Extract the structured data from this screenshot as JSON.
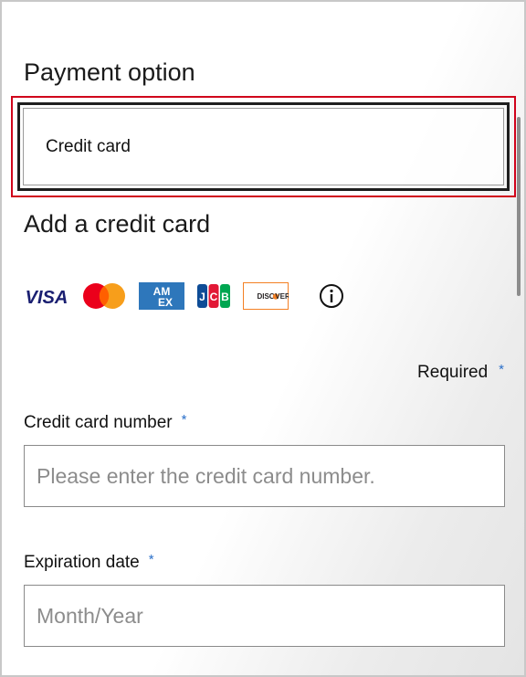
{
  "payment": {
    "title": "Payment option",
    "selected_option": "Credit card"
  },
  "add_card": {
    "title": "Add a credit card",
    "brands": [
      {
        "name": "VISA",
        "icon": "visa-icon"
      },
      {
        "name": "Mastercard",
        "icon": "mastercard-icon"
      },
      {
        "name": "AMEX",
        "icon": "amex-icon"
      },
      {
        "name": "JCB",
        "icon": "jcb-icon"
      },
      {
        "name": "DISCOVER",
        "icon": "discover-icon"
      }
    ],
    "info_icon": "info-icon"
  },
  "form": {
    "required_note": "Required",
    "asterisk": "*",
    "card_number": {
      "label": "Credit card number",
      "value": "",
      "placeholder": "Please enter the credit card number."
    },
    "expiration": {
      "label": "Expiration date",
      "value": "",
      "placeholder": "Month/Year"
    }
  },
  "colors": {
    "highlight_border": "#d0021b",
    "asterisk": "#2a6fc9",
    "visa_blue": "#1a1f71",
    "mastercard_red": "#eb001b",
    "mastercard_orange": "#f79e1b",
    "amex_blue": "#2e77bb",
    "discover_orange": "#f48024"
  }
}
